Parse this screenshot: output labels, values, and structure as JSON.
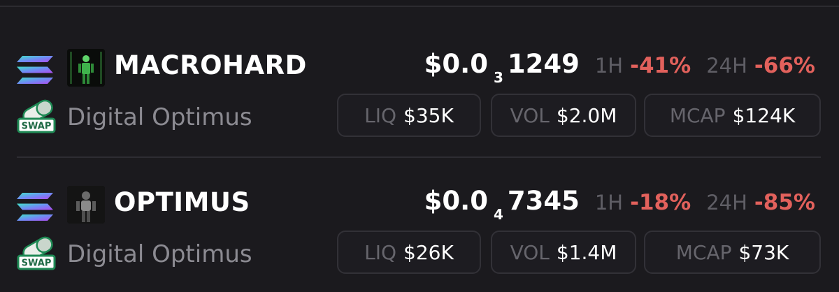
{
  "tokens": [
    {
      "symbol": "MACROHARD",
      "name": "Digital Optimus",
      "price_prefix": "$0.0",
      "price_zeros": "3",
      "price_digits": "1249",
      "change_1h_label": "1H",
      "change_1h": "-41%",
      "change_24h_label": "24H",
      "change_24h": "-66%",
      "liq_label": "LIQ",
      "liq": "$35K",
      "vol_label": "VOL",
      "vol": "$2.0M",
      "mcap_label": "MCAP",
      "mcap": "$124K",
      "chain_icon": "solana-icon",
      "dex_icon": "pill-swap-icon",
      "avatar_icon": "robot-avatar"
    },
    {
      "symbol": "OPTIMUS",
      "name": "Digital Optimus",
      "price_prefix": "$0.0",
      "price_zeros": "4",
      "price_digits": "7345",
      "change_1h_label": "1H",
      "change_1h": "-18%",
      "change_24h_label": "24H",
      "change_24h": "-85%",
      "liq_label": "LIQ",
      "liq": "$26K",
      "vol_label": "VOL",
      "vol": "$1.4M",
      "mcap_label": "MCAP",
      "mcap": "$73K",
      "chain_icon": "solana-icon",
      "dex_icon": "pill-swap-icon",
      "avatar_icon": "robot-avatar"
    }
  ],
  "dex_badge_text": "SWAP",
  "colors": {
    "background": "#1b1a1e",
    "negative": "#e2615c",
    "muted": "#8c8b92",
    "pill_border": "#323137",
    "swap_green": "#1f8a55"
  }
}
